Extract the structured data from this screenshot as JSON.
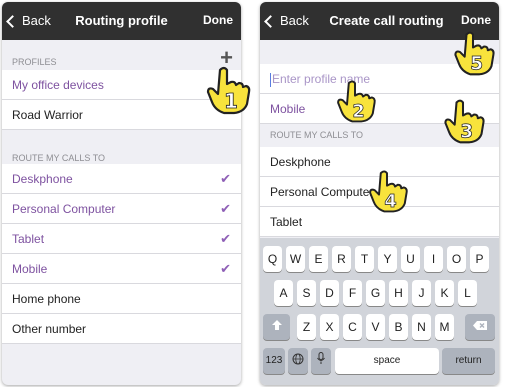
{
  "left": {
    "nav": {
      "back": "Back",
      "title": "Routing profile",
      "done": "Done"
    },
    "profiles_header": "PROFILES",
    "profiles": [
      "My office devices",
      "Road Warrior"
    ],
    "route_header": "ROUTE MY CALLS TO",
    "route_items": [
      {
        "label": "Deskphone",
        "checked": true
      },
      {
        "label": "Personal Computer",
        "checked": true
      },
      {
        "label": "Tablet",
        "checked": true
      },
      {
        "label": "Mobile",
        "checked": true
      },
      {
        "label": "Home phone",
        "checked": false
      },
      {
        "label": "Other number",
        "checked": false
      }
    ],
    "check_glyph": "✔"
  },
  "right": {
    "nav": {
      "back": "Back",
      "title": "Create call routing",
      "done": "Done"
    },
    "name_placeholder": "Enter profile name",
    "mobile_label": "Mobile",
    "route_header": "ROUTE MY CALLS TO",
    "route_items": [
      "Deskphone",
      "Personal Computer",
      "Tablet"
    ],
    "keyboard": {
      "row1": [
        "Q",
        "W",
        "E",
        "R",
        "T",
        "Y",
        "U",
        "I",
        "O",
        "P"
      ],
      "row2": [
        "A",
        "S",
        "D",
        "F",
        "G",
        "H",
        "J",
        "K",
        "L"
      ],
      "row3": [
        "Z",
        "X",
        "C",
        "V",
        "B",
        "N",
        "M"
      ],
      "numbers_key": "123",
      "space_key": "space",
      "return_key": "return"
    }
  },
  "steps": [
    "1",
    "2",
    "3",
    "4",
    "5"
  ],
  "colors": {
    "nav": "#303030",
    "purple": "#7e52a0",
    "badge_yellow": "#f8e33c"
  }
}
